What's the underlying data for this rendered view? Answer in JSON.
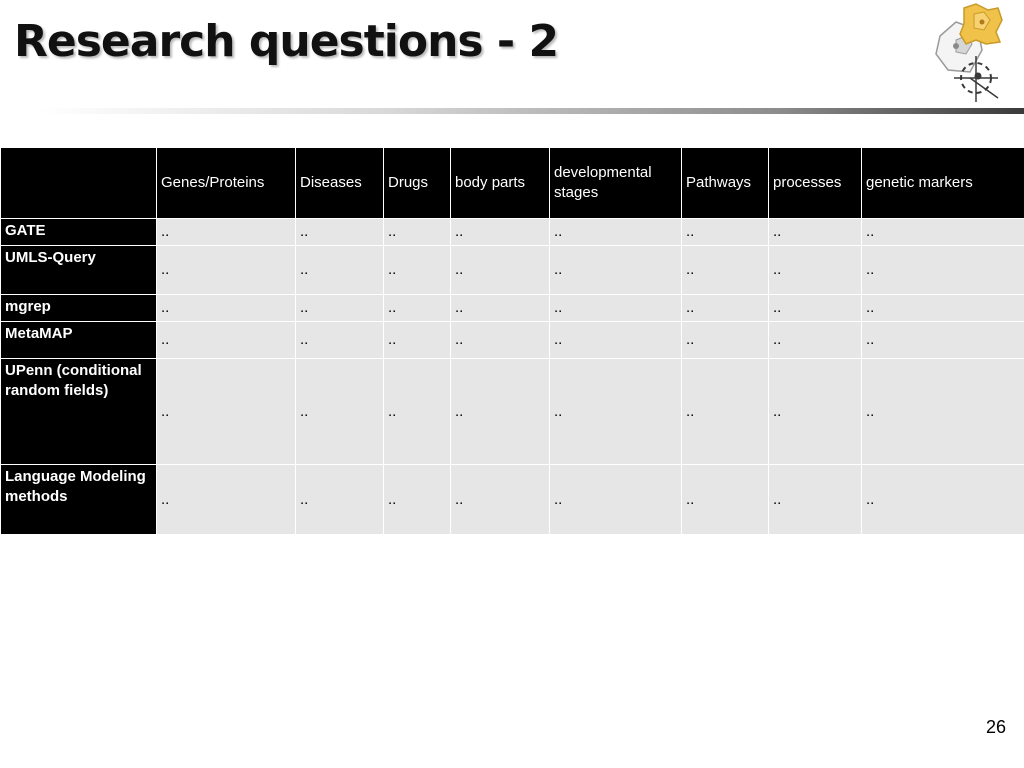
{
  "slide": {
    "title": "Research questions - 2",
    "page_number": "26"
  },
  "table": {
    "corner_label": "",
    "columns": [
      "Genes/Proteins",
      "Diseases",
      "Drugs",
      "body parts",
      "developmental stages",
      "Pathways",
      "processes",
      "genetic markers"
    ],
    "rows": [
      {
        "label": "GATE",
        "cells": [
          "..",
          "..",
          "..",
          "..",
          "..",
          "..",
          "..",
          ".."
        ]
      },
      {
        "label": "UMLS-Query",
        "cells": [
          "..",
          "..",
          "..",
          "..",
          "..",
          "..",
          "..",
          ".."
        ]
      },
      {
        "label": "mgrep",
        "cells": [
          "..",
          "..",
          "..",
          "..",
          "..",
          "..",
          "..",
          ".."
        ]
      },
      {
        "label": "MetaMAP",
        "cells": [
          "..",
          "..",
          "..",
          "..",
          "..",
          "..",
          "..",
          ".."
        ]
      },
      {
        "label": "UPenn (conditional random fields)",
        "cells": [
          "..",
          "..",
          "..",
          "..",
          "..",
          "..",
          "..",
          ".."
        ]
      },
      {
        "label": "Language Modeling methods",
        "cells": [
          "..",
          "..",
          "..",
          "..",
          "..",
          "..",
          "..",
          ".."
        ]
      }
    ]
  },
  "colors": {
    "header_background": "#000000",
    "header_text": "#ffffff",
    "cell_background": "#e6e6e6",
    "logo_accent": "#f0c24a"
  },
  "icons": {
    "logo": "ontology-logo-icon"
  }
}
